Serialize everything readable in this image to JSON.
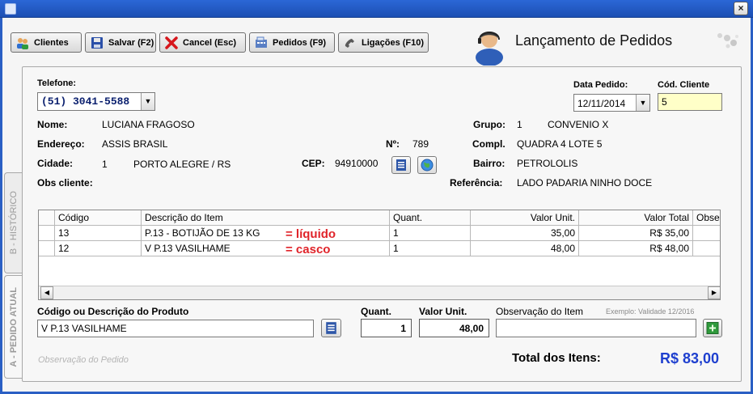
{
  "toolbar": {
    "clientes": "Clientes",
    "salvar": "Salvar (F2)",
    "cancel": "Cancel (Esc)",
    "pedidos": "Pedidos (F9)",
    "ligacoes": "Ligações (F10)"
  },
  "app": {
    "title": "Lançamento de Pedidos"
  },
  "tabs": {
    "historico": "B - HISTÓRICO",
    "pedido_atual": "A - PEDIDO ATUAL"
  },
  "form": {
    "telefone_label": "Telefone:",
    "telefone_value": "(51) 3041-5588",
    "data_label": "Data Pedido:",
    "data_value": "12/11/2014",
    "cod_label": "Cód. Cliente",
    "cod_value": "5",
    "nome_label": "Nome:",
    "nome_value": "LUCIANA FRAGOSO",
    "grupo_label": "Grupo:",
    "grupo_num": "1",
    "grupo_value": "CONVENIO X",
    "endereco_label": "Endereço:",
    "endereco_value": "ASSIS BRASIL",
    "numero_label": "Nº:",
    "numero_value": "789",
    "compl_label": "Compl.",
    "compl_value": "QUADRA 4 LOTE 5",
    "cidade_label": "Cidade:",
    "cidade_num": "1",
    "cidade_value": "PORTO ALEGRE / RS",
    "cep_label": "CEP:",
    "cep_value": "94910000",
    "bairro_label": "Bairro:",
    "bairro_value": "PETROLOLIS",
    "obs_label": "Obs cliente:",
    "ref_label": "Referência:",
    "ref_value": "LADO PADARIA NINHO DOCE"
  },
  "grid": {
    "columns": [
      "Código",
      "Descrição do Item",
      "Quant.",
      "Valor Unit.",
      "Valor Total",
      "Obser"
    ],
    "rows": [
      [
        "13",
        "P.13 - BOTIJÃO DE 13 KG",
        "1",
        "35,00",
        "R$ 35,00",
        ""
      ],
      [
        "12",
        "V P.13 VASILHAME",
        "1",
        "48,00",
        "R$ 48,00",
        ""
      ]
    ]
  },
  "annotations": {
    "liquido": "= líquido",
    "casco": "= casco"
  },
  "entry": {
    "produto_label": "Código ou Descrição do Produto",
    "produto_value": "V P.13 VASILHAME",
    "quant_label": "Quant.",
    "quant_value": "1",
    "valor_label": "Valor Unit.",
    "valor_value": "48,00",
    "obs_item_label": "Observação do Item",
    "exemplo": "Exemplo: Validade 12/2016"
  },
  "footer": {
    "obs_pedido": "Observação do Pedido",
    "total_label": "Total dos Itens:",
    "total_value": "R$ 83,00"
  },
  "icons": {
    "clientes": "users-icon",
    "salvar": "floppy-disk-icon",
    "cancel": "red-x-icon",
    "pedidos": "register-icon",
    "ligacoes": "phone-icon",
    "lookup": "list-icon",
    "globe": "globe-icon",
    "add": "add-green-icon"
  }
}
